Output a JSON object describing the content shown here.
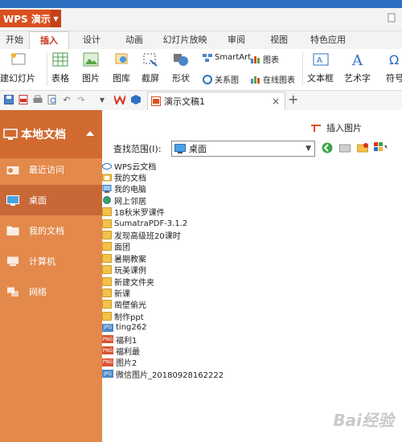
{
  "app": {
    "name": "WPS 演示",
    "login_label": ""
  },
  "tabs": [
    "开始",
    "插入",
    "设计",
    "动画",
    "幻灯片放映",
    "审阅",
    "视图",
    "特色应用"
  ],
  "ribbon": {
    "new_slide": "建幻灯片",
    "table": "表格",
    "picture": "图片",
    "gallery": "图库",
    "screenshot": "截屏",
    "shapes": "形状",
    "smartart": "SmartArt",
    "relation": "关系图",
    "chart": "图表",
    "online_chart": "在线图表",
    "textbox": "文本框",
    "wordart": "艺术字",
    "symbol": "符号"
  },
  "doc_tab": {
    "title": "演示文稿1",
    "close": "×",
    "new": "+"
  },
  "sidebar": {
    "title": "本地文档",
    "items": [
      {
        "label": "最近访问",
        "icon": "recent-folder-icon"
      },
      {
        "label": "桌面",
        "icon": "desktop-icon"
      },
      {
        "label": "我的文档",
        "icon": "my-documents-icon"
      },
      {
        "label": "计算机",
        "icon": "computer-icon"
      },
      {
        "label": "网络",
        "icon": "network-icon"
      }
    ]
  },
  "dialog": {
    "insert_picture": "插入图片",
    "scope_label": "查找范围(I):",
    "scope_value": "桌面"
  },
  "files": [
    {
      "name": "WPS云文档",
      "type": "cloud"
    },
    {
      "name": "我的文档",
      "type": "docs"
    },
    {
      "name": "我的电脑",
      "type": "computer"
    },
    {
      "name": "网上邻居",
      "type": "network"
    },
    {
      "name": "18秋米罗课件",
      "type": "folder"
    },
    {
      "name": "SumatraPDF-3.1.2",
      "type": "folder"
    },
    {
      "name": "发现高级班20课时",
      "type": "folder"
    },
    {
      "name": "面团",
      "type": "folder"
    },
    {
      "name": "暑期教案",
      "type": "folder"
    },
    {
      "name": "玩美课例",
      "type": "folder"
    },
    {
      "name": "新建文件夹",
      "type": "folder"
    },
    {
      "name": "新课",
      "type": "folder"
    },
    {
      "name": "凿壁偷光",
      "type": "folder"
    },
    {
      "name": "制作ppt",
      "type": "folder"
    },
    {
      "name": "ting262",
      "type": "jpg"
    },
    {
      "name": "福利1",
      "type": "png"
    },
    {
      "name": "福利最",
      "type": "png"
    },
    {
      "name": "图片2",
      "type": "png"
    },
    {
      "name": "微信图片_20180928162222",
      "type": "jpg"
    }
  ],
  "badges": {
    "jpg": "JPG",
    "png": "PNG"
  },
  "watermark": "Bai经验",
  "colors": {
    "brand": "#d9501f",
    "sidebar": "#e3894b",
    "sidebar_header": "#d06a30",
    "active_tab": "#c5381b"
  }
}
